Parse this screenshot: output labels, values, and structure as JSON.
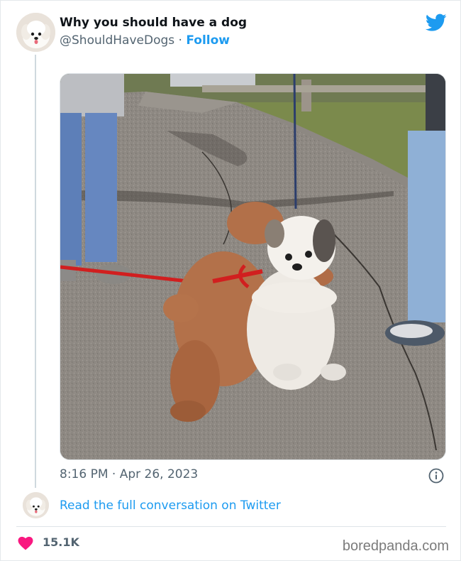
{
  "tweet": {
    "display_name": "Why you should have a dog",
    "handle": "@ShouldHaveDogs",
    "separator": " · ",
    "follow_label": "Follow",
    "timestamp": "8:16 PM · Apr 26, 2023",
    "read_conversation_label": "Read the full conversation on Twitter",
    "like_count": "15.1K"
  },
  "icons": {
    "brand": "twitter-bird-icon",
    "info": "info-icon",
    "like": "heart-icon"
  },
  "colors": {
    "link_blue": "#1d9bf0",
    "heart_pink": "#f91880",
    "muted_text": "#536471"
  },
  "watermark": "boredpanda.com"
}
